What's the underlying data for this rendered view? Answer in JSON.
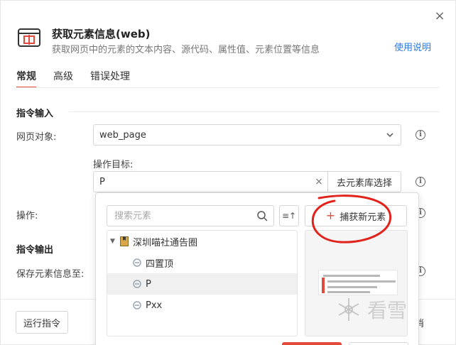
{
  "header": {
    "title": "获取元素信息(web)",
    "subtitle": "获取网页中的元素的文本内容、源代码、属性值、元素位置等信息",
    "help_link": "使用说明",
    "close_glyph": "×"
  },
  "tabs": [
    {
      "label": "常规",
      "active": true
    },
    {
      "label": "高级",
      "active": false
    },
    {
      "label": "错误处理",
      "active": false
    }
  ],
  "input_section": {
    "title": "指令输入",
    "webpage_label": "网页对象:",
    "webpage_value": "web_page",
    "target_label": "操作目标:",
    "target_value": "P",
    "target_clear": "×",
    "library_button": "去元素库选择",
    "operation_label": "操作:"
  },
  "output_section": {
    "title": "指令输出",
    "save_label": "保存元素信息至:"
  },
  "picker": {
    "search_placeholder": "搜索元素",
    "sort_glyph": "≡↑",
    "capture_plus": "+",
    "capture_button": "捕获新元素",
    "tree": {
      "group_label": "深圳喵社通告圈",
      "items": [
        {
          "label": "四置顶",
          "selected": false
        },
        {
          "label": "P",
          "selected": true
        },
        {
          "label": "Pxx",
          "selected": false
        }
      ]
    }
  },
  "footer": {
    "run_button": "运行指令",
    "right_fragment": "消"
  },
  "watermark": "看雪",
  "colors": {
    "accent": "#e34a3b",
    "link": "#2b79e4",
    "annotation": "#e0241b"
  },
  "icons": {
    "header": "element-info-icon",
    "search": "magnifier-icon",
    "dropdown": "chevron-down-icon",
    "info": "info-circle-icon",
    "folder": "bookmark-folder-icon",
    "element": "web-element-icon"
  }
}
